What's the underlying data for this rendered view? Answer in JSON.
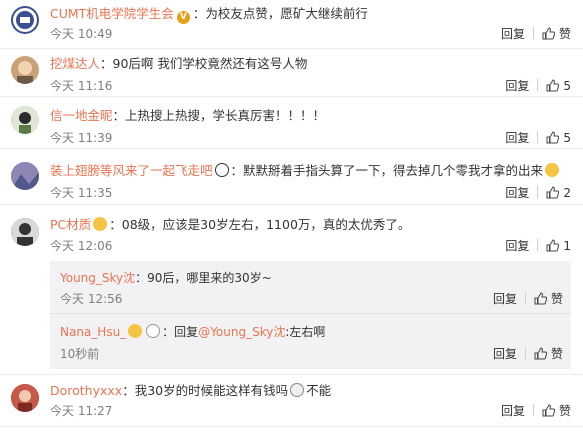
{
  "comments": [
    {
      "username": "CUMT机电学院学生会",
      "badge": "V",
      "text": "：为校友点赞，愿矿大继续前行",
      "time": "今天 10:49",
      "reply": "回复",
      "likes": "赞",
      "avatar_color": "#3a4f8f"
    },
    {
      "username": "挖煤达人",
      "text": "：90后啊  我们学校竟然还有这号人物",
      "time": "今天 11:16",
      "reply": "回复",
      "likes": "5",
      "avatar_color": "#c9a27a"
    },
    {
      "username": "信一地金昵",
      "text": "：上热搜上热搜，学长真厉害！！！！",
      "time": "今天 11:39",
      "reply": "回复",
      "likes": "5",
      "avatar_color": "#8aa86a"
    },
    {
      "username": "装上翅膀等风来了一起飞走吧",
      "text": "：默默掰着手指头算了一下，得去掉几个零我才拿的出来",
      "time": "今天 11:35",
      "reply": "回复",
      "likes": "2",
      "avatar_color": "#7a6a9a"
    },
    {
      "username": "PC材质",
      "text": "：08级，应该是30岁左右，1100万，真的太优秀了。",
      "time": "今天 12:06",
      "reply": "回复",
      "likes": "1",
      "avatar_color": "#555555"
    },
    {
      "username": "Dorothyxxx",
      "text": "：我30岁的时候能这样有钱吗",
      "suffix": "不能",
      "time": "今天 11:27",
      "reply": "回复",
      "likes": "赞",
      "avatar_color": "#b9473a"
    }
  ],
  "replies": [
    {
      "username": "Young_Sky沈",
      "text": "：90后，哪里来的30岁~",
      "time": "今天 12:56",
      "reply": "回复",
      "likes": "赞"
    },
    {
      "username": "Nana_Hsu_",
      "text": "：回复",
      "mention": "@Young_Sky沈",
      "text2": ":左右啊",
      "time": "10秒前",
      "reply": "回复",
      "likes": "赞"
    }
  ]
}
